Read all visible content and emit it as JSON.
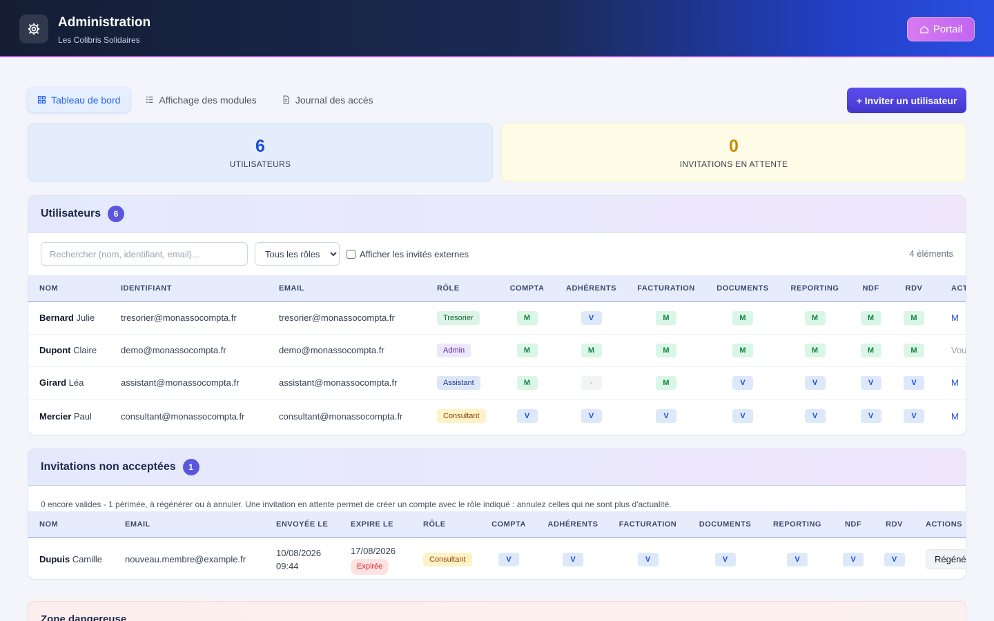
{
  "header": {
    "title": "Administration",
    "subtitle": "Les Colibris Solidaires",
    "portal_label": "Portail"
  },
  "tabs": [
    {
      "label": "Tableau de bord",
      "active": true,
      "icon": "grid-icon"
    },
    {
      "label": "Affichage des modules",
      "active": false,
      "icon": "list-icon"
    },
    {
      "label": "Journal des accès",
      "active": false,
      "icon": "document-icon"
    }
  ],
  "invite_button_label": "+ Inviter un utilisateur",
  "stats": {
    "users": {
      "value": "6",
      "label": "UTILISATEURS"
    },
    "invitations": {
      "value": "0",
      "label": "INVITATIONS EN ATTENTE"
    }
  },
  "users_panel": {
    "title": "Utilisateurs",
    "count": "6",
    "search_placeholder": "Rechercher (nom, identifiant, email)...",
    "role_filter": "Tous les rôles",
    "external_label": "Afficher les invités externes",
    "elements_count": "4 éléments",
    "columns": [
      "NOM",
      "IDENTIFIANT",
      "EMAIL",
      "RÔLE",
      "COMPTA",
      "ADHÉRENTS",
      "FACTURATION",
      "DOCUMENTS",
      "REPORTING",
      "NDF",
      "RDV",
      "ACTIONS"
    ],
    "rows": [
      {
        "last": "Bernard",
        "first": "Julie",
        "identifiant": "tresorier@monassocompta.fr",
        "email": "tresorier@monassocompta.fr",
        "role": "Tresorier",
        "role_class": "tresorier",
        "perms": [
          "M",
          "V",
          "M",
          "M",
          "M",
          "M",
          "M"
        ],
        "action": "M"
      },
      {
        "last": "Dupont",
        "first": "Claire",
        "identifiant": "demo@monassocompta.fr",
        "email": "demo@monassocompta.fr",
        "role": "Admin",
        "role_class": "admin",
        "perms": [
          "M",
          "M",
          "M",
          "M",
          "M",
          "M",
          "M"
        ],
        "action": "Vous"
      },
      {
        "last": "Girard",
        "first": "Léa",
        "identifiant": "assistant@monassocompta.fr",
        "email": "assistant@monassocompta.fr",
        "role": "Assistant",
        "role_class": "assistant",
        "perms": [
          "M",
          "-",
          "M",
          "V",
          "V",
          "V",
          "V"
        ],
        "action": "M"
      },
      {
        "last": "Mercier",
        "first": "Paul",
        "identifiant": "consultant@monassocompta.fr",
        "email": "consultant@monassocompta.fr",
        "role": "Consultant",
        "role_class": "consultant",
        "perms": [
          "V",
          "V",
          "V",
          "V",
          "V",
          "V",
          "V"
        ],
        "action": "M"
      }
    ]
  },
  "invitations_panel": {
    "title": "Invitations non acceptées",
    "count": "1",
    "note": "0 encore valides - 1 périmée, à régénérer ou à annuler. Une invitation en attente permet de créer un compte avec le rôle indiqué : annulez celles qui ne sont plus d'actualité.",
    "columns": [
      "NOM",
      "EMAIL",
      "ENVOYÉE LE",
      "EXPIRE LE",
      "RÔLE",
      "COMPTA",
      "ADHÉRENTS",
      "FACTURATION",
      "DOCUMENTS",
      "REPORTING",
      "NDF",
      "RDV",
      "ACTIONS"
    ],
    "rows": [
      {
        "last": "Dupuis",
        "first": "Camille",
        "email": "nouveau.membre@example.fr",
        "sent_date": "10/08/2026",
        "sent_time": "09:44",
        "expire_date": "17/08/2026",
        "expired_label": "Expirée",
        "role": "Consultant",
        "role_class": "consultant",
        "perms": [
          "V",
          "V",
          "V",
          "V",
          "V",
          "V",
          "V"
        ],
        "action": "Régénérer"
      }
    ]
  },
  "danger_zone": {
    "title": "Zone dangereuse"
  },
  "colors": {
    "accent": "#4338ca",
    "manage": "#15803d",
    "view": "#1d4ed8",
    "expired": "#dc2626"
  }
}
